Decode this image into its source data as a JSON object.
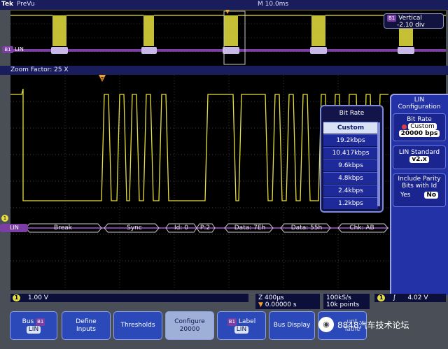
{
  "top_bar": {
    "brand": "Tek",
    "mode": "PreVu",
    "timebase": "M 10.0ms"
  },
  "overview": {
    "channel_label": "LIN",
    "bus_chip": "B1",
    "vertical_title": "Vertical",
    "vertical_value": "-2.10 div"
  },
  "zoom_bar": {
    "label": "Zoom Factor: 25 X"
  },
  "bus_decode": {
    "channel_label": "LIN",
    "fields": [
      "Break",
      "Sync",
      "Id: 0",
      "P:2",
      "Data: 7Eh",
      "Data: 55h",
      "Chk: AB"
    ]
  },
  "bit_rate_menu": {
    "title": "Bit Rate",
    "options": [
      "Custom",
      "19.2kbps",
      "10.417kbps",
      "9.6kbps",
      "4.8kbps",
      "2.4kbps",
      "1.2kbps"
    ],
    "selected": "Custom"
  },
  "side_panel": {
    "title_line1": "LIN",
    "title_line2": "Configuration",
    "bit_rate_label": "Bit Rate",
    "bit_rate_mode": "Custom",
    "bit_rate_value": "20000 bps",
    "standard_label": "LIN Standard",
    "standard_value": "v2.x",
    "parity_label_1": "Include Parity",
    "parity_label_2": "Bits with Id",
    "parity_yes": "Yes",
    "parity_no": "No"
  },
  "readouts": {
    "ch1_marker": "1",
    "ch1_scale": "1.00 V",
    "zoom_scale": "Z 400µs",
    "trigger_pos": "0.00000 s",
    "sample_rate": "100kS/s",
    "record_length": "10k points",
    "trigger_level": "4.02 V"
  },
  "buttons": [
    {
      "line1": "Bus",
      "chip": "B1",
      "line2": "LIN"
    },
    {
      "line1": "Define",
      "line2": "Inputs"
    },
    {
      "line1": "Thresholds",
      "line2": ""
    },
    {
      "line1": "Configure",
      "line2": "20000"
    },
    {
      "chip": "B1",
      "line1": "Label",
      "line2": "LIN"
    },
    {
      "line1": "Bus Display",
      "line2": ""
    }
  ],
  "watermark": {
    "text": "8848汽车技术论坛",
    "partial_label": "unt Table"
  },
  "colors": {
    "trace": "#e8e040",
    "bus": "#7b3fa3",
    "panel": "#2332a6",
    "grid": "#3a3a3a"
  }
}
